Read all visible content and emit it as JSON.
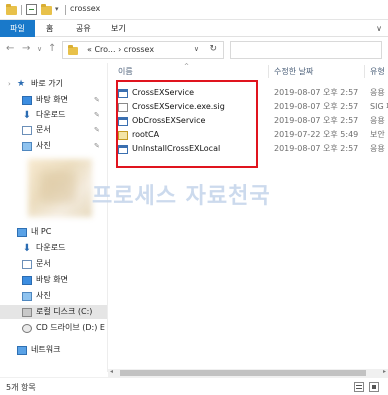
{
  "window": {
    "title": "crossex",
    "titlebar_icons": [
      "folder-icon",
      "properties-icon",
      "new-folder-icon",
      "quick-access-dropdown-icon"
    ]
  },
  "ribbon": {
    "tabs": [
      {
        "label": "파일",
        "active": true
      },
      {
        "label": "홈"
      },
      {
        "label": "공유"
      },
      {
        "label": "보기"
      }
    ],
    "expand_icon": "chevron-down-icon"
  },
  "address": {
    "back": "←",
    "forward": "→",
    "recent": "∨",
    "up": "↑",
    "path": "« Cro... › crossex",
    "dropdown": "∨",
    "refresh": "↻",
    "search_placeholder": ""
  },
  "navpane": {
    "items": [
      {
        "label": "바로 가기",
        "icon": "star-icon",
        "pinned": false
      },
      {
        "label": "바탕 화면",
        "icon": "desktop-icon",
        "pinned": true
      },
      {
        "label": "다운로드",
        "icon": "download-icon",
        "pinned": true
      },
      {
        "label": "문서",
        "icon": "documents-icon",
        "pinned": true
      },
      {
        "label": "사진",
        "icon": "pictures-icon",
        "pinned": true
      },
      {
        "label": "3D 개체",
        "icon": "3d-objects-icon",
        "pinned": false
      },
      {
        "label": "내 PC",
        "icon": "this-pc-icon",
        "pinned": false
      },
      {
        "label": "다운로드",
        "icon": "download-icon",
        "pinned": false
      },
      {
        "label": "문서",
        "icon": "documents-icon",
        "pinned": false
      },
      {
        "label": "바탕 화면",
        "icon": "desktop-icon",
        "pinned": false
      },
      {
        "label": "사진",
        "icon": "pictures-icon",
        "pinned": false
      },
      {
        "label": "로컬 디스크 (C:)",
        "icon": "drive-icon",
        "pinned": false,
        "selected": true
      },
      {
        "label": "CD 드라이브 (D:) E",
        "icon": "cd-drive-icon",
        "pinned": false
      },
      {
        "label": "네트워크",
        "icon": "network-icon",
        "pinned": false
      }
    ],
    "pin_glyph": "✎"
  },
  "filelist": {
    "columns": [
      "이름",
      "수정한 날짜",
      "유형"
    ],
    "sort_indicator": "^",
    "rows": [
      {
        "name": "CrossEXService",
        "date": "2019-08-07 오후 2:57",
        "type": "응용",
        "icon": "exe-icon"
      },
      {
        "name": "CrossEXService.exe.sig",
        "date": "2019-08-07 오후 2:57",
        "type": "SIG 파",
        "icon": "sig-file-icon"
      },
      {
        "name": "ObCrossEXService",
        "date": "2019-08-07 오후 2:57",
        "type": "응용",
        "icon": "exe-icon"
      },
      {
        "name": "rootCA",
        "date": "2019-07-22 오후 5:49",
        "type": "보안",
        "icon": "certificate-icon"
      },
      {
        "name": "UnInstallCrossEXLocal",
        "date": "2019-08-07 오후 2:57",
        "type": "응용",
        "icon": "exe-icon"
      }
    ]
  },
  "watermark": "프로세스 자료천국",
  "statusbar": {
    "item_count": "5개 항목"
  },
  "colors": {
    "file_tab": "#1979ca",
    "highlight": "#e0141e",
    "watermark": "#c7d7ec"
  }
}
